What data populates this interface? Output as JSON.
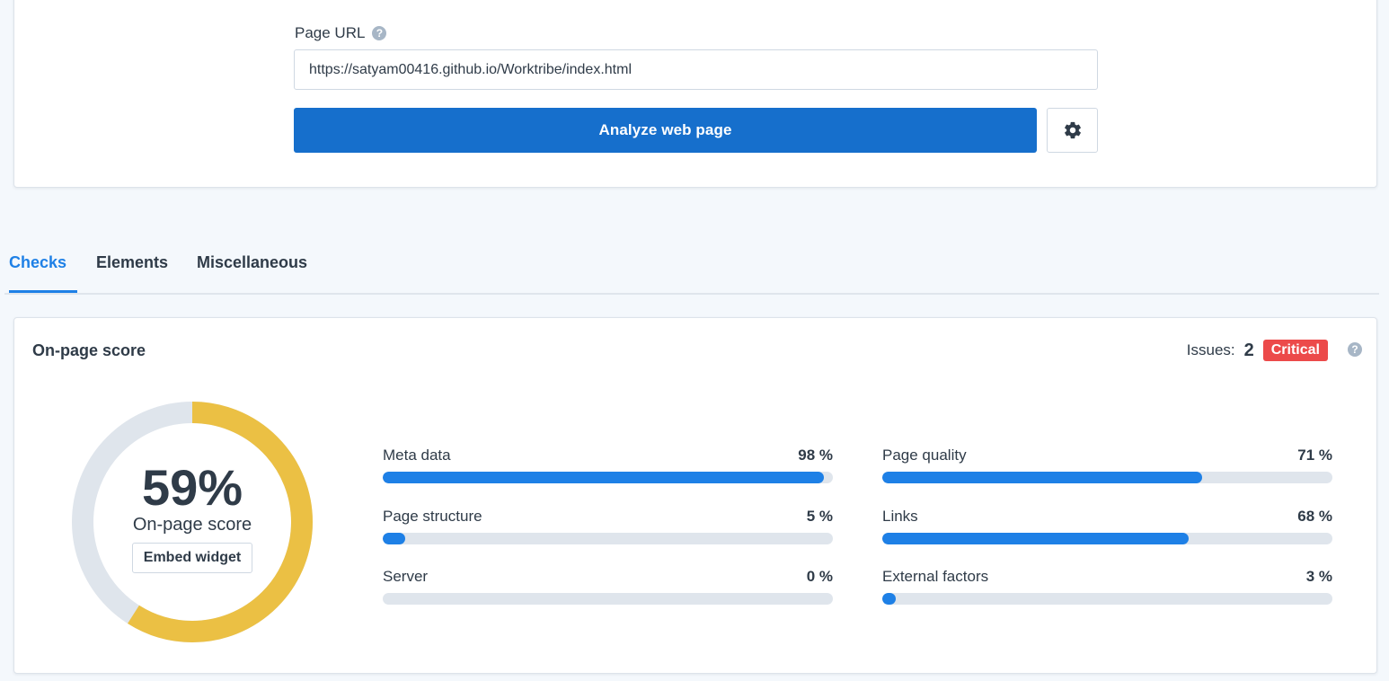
{
  "form": {
    "url_label": "Page URL",
    "url_value": "https://satyam00416.github.io/Worktribe/index.html",
    "analyze_label": "Analyze web page",
    "settings_icon": "gear-icon",
    "help_icon": "question-circle-icon"
  },
  "tabs": [
    {
      "label": "Checks",
      "active": true
    },
    {
      "label": "Elements",
      "active": false
    },
    {
      "label": "Miscellaneous",
      "active": false
    }
  ],
  "score_card": {
    "title": "On-page score",
    "issues_label": "Issues:",
    "issues_count": "2",
    "issues_badge": "Critical",
    "score_value": "59%",
    "score_fraction": 0.59,
    "score_label": "On-page score",
    "embed_label": "Embed widget"
  },
  "metrics": [
    {
      "name": "Meta data",
      "value_text": "98 %",
      "value": 98
    },
    {
      "name": "Page quality",
      "value_text": "71 %",
      "value": 71
    },
    {
      "name": "Page structure",
      "value_text": "5 %",
      "value": 5
    },
    {
      "name": "Links",
      "value_text": "68 %",
      "value": 68
    },
    {
      "name": "Server",
      "value_text": "0 %",
      "value": 0
    },
    {
      "name": "External factors",
      "value_text": "3 %",
      "value": 3
    }
  ],
  "colors": {
    "accent": "#1e80e6",
    "button": "#166fcc",
    "score_ring": "#ebc044",
    "ring_track": "#dfe5ec",
    "critical": "#ec4a4a"
  }
}
